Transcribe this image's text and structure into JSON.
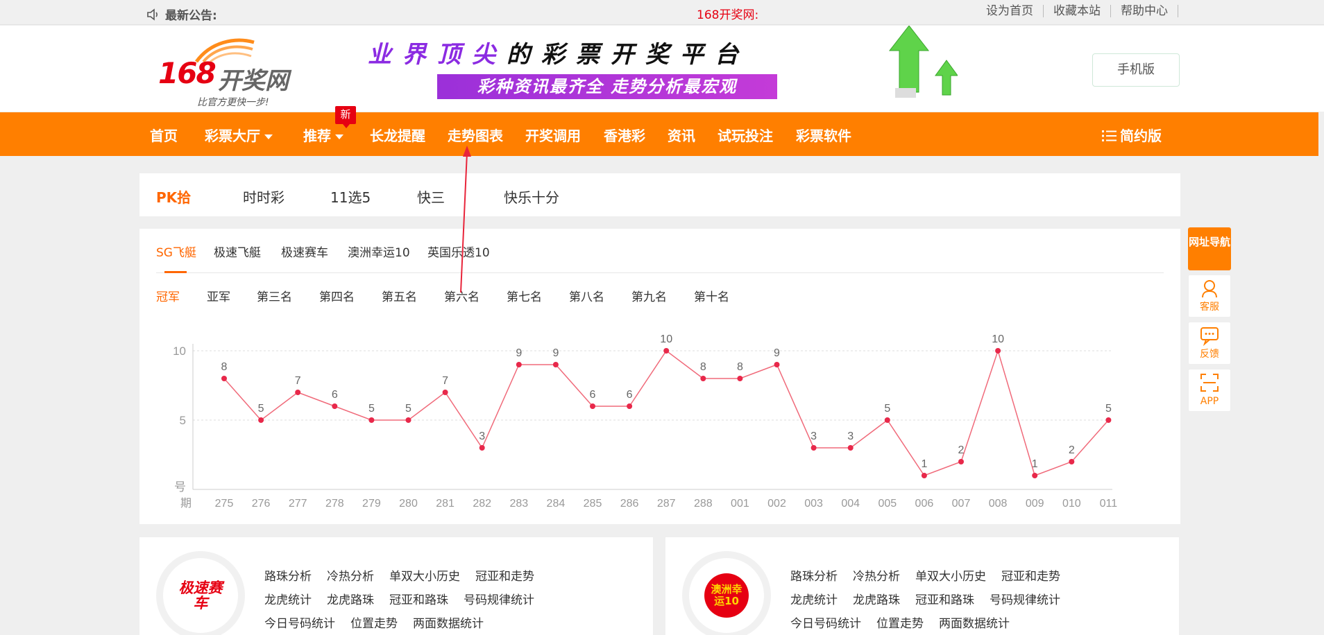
{
  "topbar": {
    "notice_label": "最新公告:",
    "marquee": "168开奖网:",
    "links": [
      "设为首页",
      "收藏本站",
      "帮助中心"
    ]
  },
  "header": {
    "logo_number": "168",
    "logo_name": "开奖网",
    "logo_slogan": "比官方更快一步!",
    "banner_line1_a": "业界顶尖",
    "banner_line1_b": "的彩票开奖平台",
    "banner_line2": "彩种资讯最齐全  走势分析最宏观",
    "mobile_button": "手机版"
  },
  "nav": {
    "items": [
      "首页",
      "彩票大厅",
      "推荐",
      "长龙提醒",
      "走势图表",
      "开奖调用",
      "香港彩",
      "资讯",
      "试玩投注",
      "彩票软件"
    ],
    "new_badge": "新",
    "simple_version": "简约版"
  },
  "categories": [
    "PK拾",
    "时时彩",
    "11选5",
    "快三",
    "快乐十分"
  ],
  "sub_tabs": [
    "SG飞艇",
    "极速飞艇",
    "极速赛车",
    "澳洲幸运10",
    "英国乐透10"
  ],
  "position_tabs": [
    "冠军",
    "亚军",
    "第三名",
    "第四名",
    "第五名",
    "第六名",
    "第七名",
    "第八名",
    "第九名",
    "第十名"
  ],
  "chart_data": {
    "type": "line",
    "title": "",
    "xlabel": "期",
    "ylabel": "号",
    "ylim": [
      0,
      10
    ],
    "yticks": [
      5,
      10
    ],
    "grid": true,
    "color": "#f06a7a",
    "point_color": "#e8284a",
    "x": [
      "275",
      "276",
      "277",
      "278",
      "279",
      "280",
      "281",
      "282",
      "283",
      "284",
      "285",
      "286",
      "287",
      "288",
      "001",
      "002",
      "003",
      "004",
      "005",
      "006",
      "007",
      "008",
      "009",
      "010",
      "011"
    ],
    "values": [
      8,
      5,
      7,
      6,
      5,
      5,
      7,
      3,
      9,
      9,
      6,
      6,
      10,
      8,
      8,
      9,
      3,
      3,
      5,
      1,
      2,
      10,
      1,
      2,
      5
    ]
  },
  "side_tools": [
    "网址导航",
    "客服",
    "反馈",
    "APP"
  ],
  "bottom_panels": [
    {
      "logo_text": "极速赛车",
      "links": [
        [
          "路珠分析",
          "冷热分析",
          "单双大小历史",
          "冠亚和走势"
        ],
        [
          "龙虎统计",
          "龙虎路珠",
          "冠亚和路珠",
          "号码规律统计"
        ],
        [
          "今日号码统计",
          "位置走势",
          "两面数据统计"
        ]
      ]
    },
    {
      "logo_text": "澳洲幸运10",
      "links": [
        [
          "路珠分析",
          "冷热分析",
          "单双大小历史",
          "冠亚和走势"
        ],
        [
          "龙虎统计",
          "龙虎路珠",
          "冠亚和路珠",
          "号码规律统计"
        ],
        [
          "今日号码统计",
          "位置走势",
          "两面数据统计"
        ]
      ]
    }
  ],
  "colors": {
    "brand_orange": "#ff7f00",
    "active_text": "#ff6600",
    "red": "#e60012"
  }
}
